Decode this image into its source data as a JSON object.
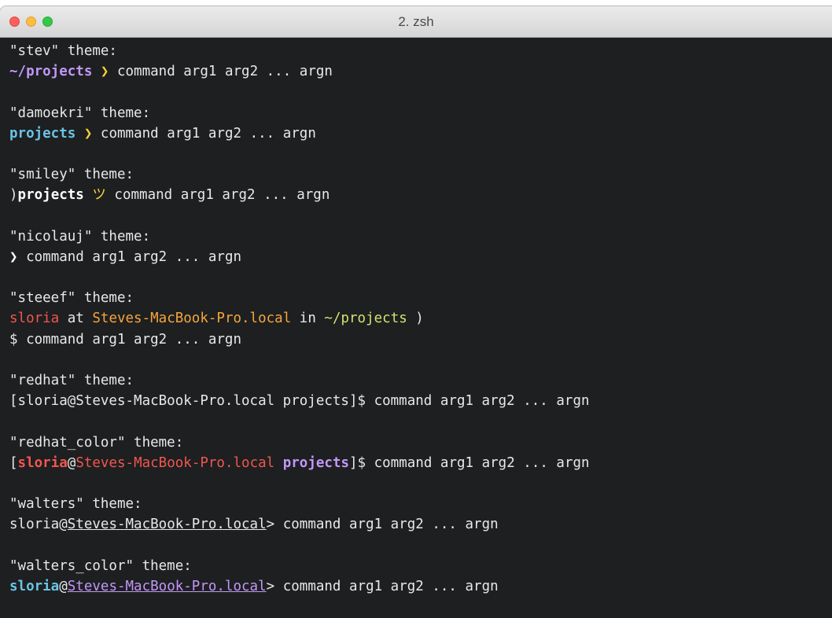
{
  "window": {
    "title": "2. zsh"
  },
  "colors": {
    "background": "#1d1f21",
    "text": "#e8e8e8",
    "purple": "#c397f7",
    "cyan": "#6bc3e6",
    "red": "#f2564e",
    "orange": "#f5a63a",
    "yellow_green": "#d5e070"
  },
  "terminal": {
    "blocks": [
      {
        "label": "\"stev\" theme:",
        "lines": [
          [
            {
              "text": "~/projects",
              "color": "#c397f7",
              "bold": true
            },
            {
              "text": " ",
              "color": "#e8e8e8"
            },
            {
              "text": "❯",
              "color": "#f5d03a",
              "bold": true
            },
            {
              "text": " command arg1 arg2 ... argn",
              "color": "#e8e8e8"
            }
          ]
        ]
      },
      {
        "label": "\"damoekri\" theme:",
        "lines": [
          [
            {
              "text": "projects",
              "color": "#6bc3e6",
              "bold": true
            },
            {
              "text": " ",
              "color": "#e8e8e8"
            },
            {
              "text": "❯",
              "color": "#f5d03a",
              "bold": true
            },
            {
              "text": " command arg1 arg2 ... argn",
              "color": "#e8e8e8"
            }
          ]
        ]
      },
      {
        "label": "\"smiley\" theme:",
        "lines": [
          [
            {
              "text": ")",
              "color": "#e8e8e8"
            },
            {
              "text": "projects",
              "color": "#ffffff",
              "bold": true
            },
            {
              "text": " ",
              "color": "#e8e8e8"
            },
            {
              "text": "ツ",
              "color": "#f5d03a"
            },
            {
              "text": " command arg1 arg2 ... argn",
              "color": "#e8e8e8"
            }
          ]
        ]
      },
      {
        "label": "\"nicolauj\" theme:",
        "lines": [
          [
            {
              "text": "❯",
              "color": "#ffffff",
              "bold": true
            },
            {
              "text": " command arg1 arg2 ... argn",
              "color": "#e8e8e8"
            }
          ]
        ]
      },
      {
        "label": "\"steeef\" theme:",
        "lines": [
          [
            {
              "text": "sloria",
              "color": "#f2564e"
            },
            {
              "text": " at ",
              "color": "#e8e8e8"
            },
            {
              "text": "Steves-MacBook-Pro.local",
              "color": "#f5a63a"
            },
            {
              "text": " in ",
              "color": "#e8e8e8"
            },
            {
              "text": "~/projects",
              "color": "#d5e070"
            },
            {
              "text": " )",
              "color": "#e8e8e8"
            }
          ],
          [
            {
              "text": "$ command arg1 arg2 ... argn",
              "color": "#e8e8e8"
            }
          ]
        ]
      },
      {
        "label": "\"redhat\" theme:",
        "lines": [
          [
            {
              "text": "[sloria@Steves-MacBook-Pro.local projects]$ command arg1 arg2 ... argn",
              "color": "#e8e8e8"
            }
          ]
        ]
      },
      {
        "label": "\"redhat_color\" theme:",
        "lines": [
          [
            {
              "text": "[",
              "color": "#e8e8e8"
            },
            {
              "text": "sloria",
              "color": "#f2564e",
              "bold": true
            },
            {
              "text": "@",
              "color": "#e8e8e8"
            },
            {
              "text": "Steves-MacBook-Pro.local",
              "color": "#f2564e"
            },
            {
              "text": " ",
              "color": "#e8e8e8"
            },
            {
              "text": "projects",
              "color": "#c397f7",
              "bold": true
            },
            {
              "text": "]$ command arg1 arg2 ... argn",
              "color": "#e8e8e8"
            }
          ]
        ]
      },
      {
        "label": "\"walters\" theme:",
        "lines": [
          [
            {
              "text": "sloria@",
              "color": "#e8e8e8"
            },
            {
              "text": "Steves-MacBook-Pro.local",
              "color": "#e8e8e8",
              "underline": true
            },
            {
              "text": "> command arg1 arg2 ... argn",
              "color": "#e8e8e8"
            }
          ]
        ]
      },
      {
        "label": "\"walters_color\" theme:",
        "lines": [
          [
            {
              "text": "sloria",
              "color": "#6bc3e6",
              "bold": true
            },
            {
              "text": "@",
              "color": "#e8e8e8"
            },
            {
              "text": "Steves-MacBook-Pro.local",
              "color": "#c397f7",
              "underline": true
            },
            {
              "text": "> command arg1 arg2 ... argn",
              "color": "#e8e8e8"
            }
          ]
        ]
      }
    ]
  }
}
